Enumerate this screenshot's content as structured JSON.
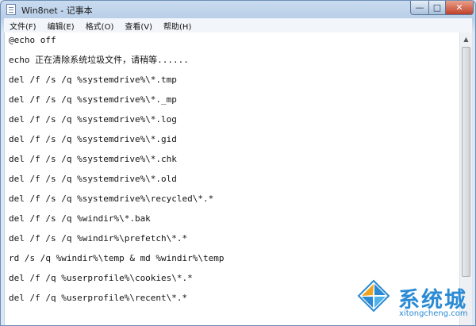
{
  "window": {
    "title": "Win8net - 记事本"
  },
  "controls": {
    "minimize": "—",
    "maximize": "□",
    "close": "✕"
  },
  "menu": [
    "文件(F)",
    "编辑(E)",
    "格式(O)",
    "查看(V)",
    "帮助(H)"
  ],
  "lines": [
    "@echo off",
    "echo 正在清除系统垃圾文件，请稍等......",
    "del /f /s /q %systemdrive%\\*.tmp",
    "del /f /s /q %systemdrive%\\*._mp",
    "del /f /s /q %systemdrive%\\*.log",
    "del /f /s /q %systemdrive%\\*.gid",
    "del /f /s /q %systemdrive%\\*.chk",
    "del /f /s /q %systemdrive%\\*.old",
    "del /f /s /q %systemdrive%\\recycled\\*.*",
    "del /f /s /q %windir%\\*.bak",
    "del /f /s /q %windir%\\prefetch\\*.*",
    "rd /s /q %windir%\\temp & md %windir%\\temp",
    "del /f /q %userprofile%\\cookies\\*.*",
    "del /f /q %userprofile%\\recent\\*.*"
  ],
  "icons": {
    "app": "notepad-icon",
    "scroll_up": "arrow-up-icon",
    "logo": "windows-logo-icon"
  },
  "watermark": {
    "brand": "系统城",
    "domain": "xitongcheng.com"
  },
  "colors": {
    "watermark": "#2a8ad3",
    "close": "#c0412a"
  }
}
